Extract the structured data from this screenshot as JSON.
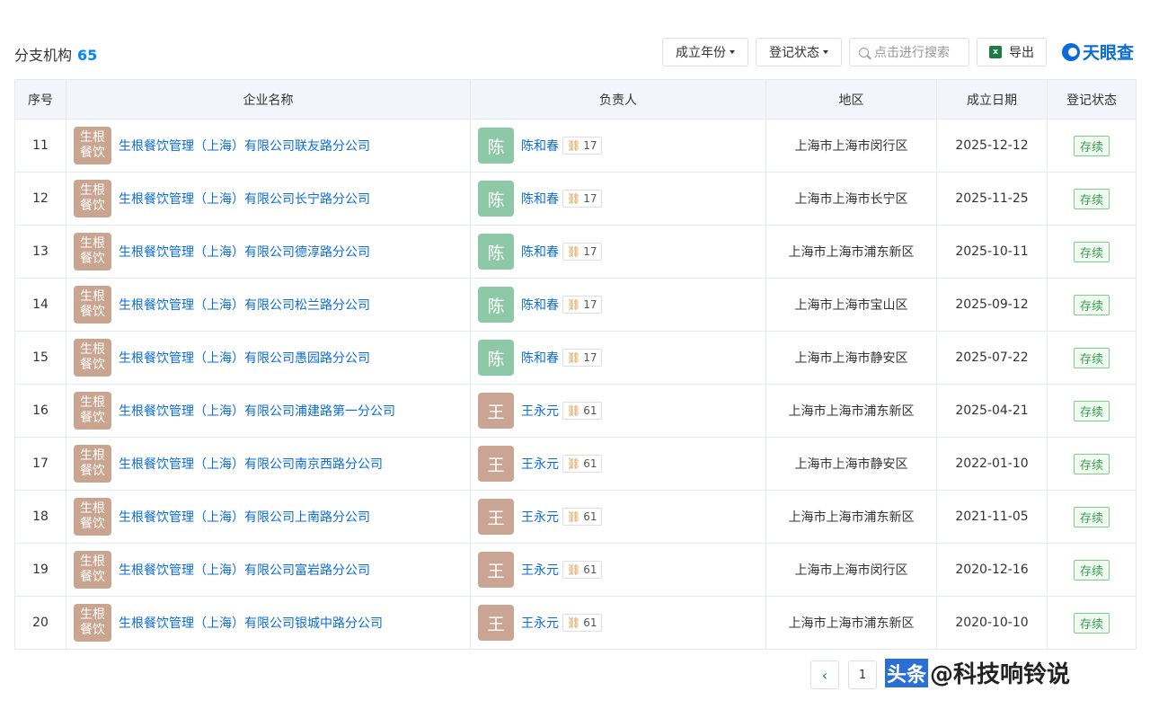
{
  "header": {
    "title": "分支机构",
    "count": "65",
    "filter_year": "成立年份",
    "filter_status": "登记状态",
    "search_placeholder": "点击进行搜索",
    "export_label": "导出",
    "brand": "天眼查"
  },
  "table": {
    "columns": [
      "序号",
      "企业名称",
      "负责人",
      "地区",
      "成立日期",
      "登记状态"
    ],
    "company_logo_text": "生根餐饮",
    "rows": [
      {
        "no": "11",
        "company": "生根餐饮管理（上海）有限公司联友路分公司",
        "avatar": "陈",
        "person": "陈和春",
        "links": "17",
        "region": "上海市上海市闵行区",
        "date": "2025-12-12",
        "status": "存续"
      },
      {
        "no": "12",
        "company": "生根餐饮管理（上海）有限公司长宁路分公司",
        "avatar": "陈",
        "person": "陈和春",
        "links": "17",
        "region": "上海市上海市长宁区",
        "date": "2025-11-25",
        "status": "存续"
      },
      {
        "no": "13",
        "company": "生根餐饮管理（上海）有限公司德淳路分公司",
        "avatar": "陈",
        "person": "陈和春",
        "links": "17",
        "region": "上海市上海市浦东新区",
        "date": "2025-10-11",
        "status": "存续"
      },
      {
        "no": "14",
        "company": "生根餐饮管理（上海）有限公司松兰路分公司",
        "avatar": "陈",
        "person": "陈和春",
        "links": "17",
        "region": "上海市上海市宝山区",
        "date": "2025-09-12",
        "status": "存续"
      },
      {
        "no": "15",
        "company": "生根餐饮管理（上海）有限公司愚园路分公司",
        "avatar": "陈",
        "person": "陈和春",
        "links": "17",
        "region": "上海市上海市静安区",
        "date": "2025-07-22",
        "status": "存续"
      },
      {
        "no": "16",
        "company": "生根餐饮管理（上海）有限公司浦建路第一分公司",
        "avatar": "王",
        "person": "王永元",
        "links": "61",
        "region": "上海市上海市浦东新区",
        "date": "2025-04-21",
        "status": "存续"
      },
      {
        "no": "17",
        "company": "生根餐饮管理（上海）有限公司南京西路分公司",
        "avatar": "王",
        "person": "王永元",
        "links": "61",
        "region": "上海市上海市静安区",
        "date": "2022-01-10",
        "status": "存续"
      },
      {
        "no": "18",
        "company": "生根餐饮管理（上海）有限公司上南路分公司",
        "avatar": "王",
        "person": "王永元",
        "links": "61",
        "region": "上海市上海市浦东新区",
        "date": "2021-11-05",
        "status": "存续"
      },
      {
        "no": "19",
        "company": "生根餐饮管理（上海）有限公司富岩路分公司",
        "avatar": "王",
        "person": "王永元",
        "links": "61",
        "region": "上海市上海市闵行区",
        "date": "2020-12-16",
        "status": "存续"
      },
      {
        "no": "20",
        "company": "生根餐饮管理（上海）有限公司银城中路分公司",
        "avatar": "王",
        "person": "王永元",
        "links": "61",
        "region": "上海市上海市浦东新区",
        "date": "2020-10-10",
        "status": "存续"
      }
    ]
  },
  "pagination": {
    "prev_icon": "chevron-left-icon",
    "current_page": "1"
  },
  "watermark": {
    "brand": "头条",
    "handle": "@科技响铃说"
  },
  "colors": {
    "link": "#0a6cd9",
    "accent_count": "#0084ff",
    "status_green": "#3c9e4f",
    "header_bg": "#f2f6fa"
  }
}
